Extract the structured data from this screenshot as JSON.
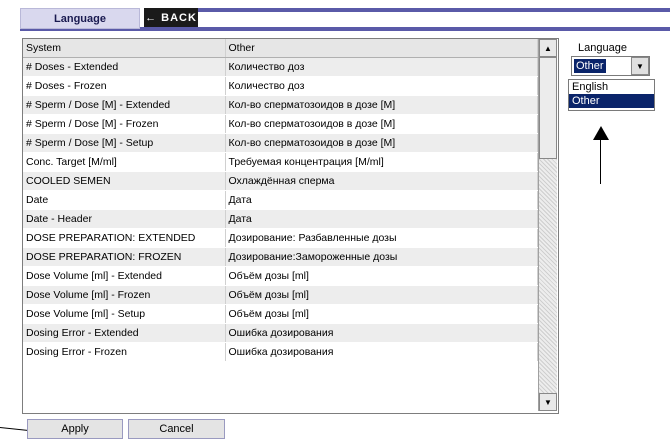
{
  "header": {
    "tab_label": "Language",
    "back_label": "← BACK"
  },
  "table": {
    "columns": [
      "System",
      "Other"
    ],
    "rows": [
      [
        "# Doses - Extended",
        "Количество доз"
      ],
      [
        "# Doses - Frozen",
        "Количество доз"
      ],
      [
        "# Sperm / Dose [M] - Extended",
        "Кол-во сперматозоидов в дозе [M]"
      ],
      [
        "# Sperm / Dose [M] - Frozen",
        "Кол-во сперматозоидов в дозе [M]"
      ],
      [
        "# Sperm / Dose [M] - Setup",
        "Кол-во сперматозоидов в дозе [M]"
      ],
      [
        "Conc. Target [M/ml]",
        "Требуемая концентрация [M/ml]"
      ],
      [
        "COOLED SEMEN",
        "Охлаждённая сперма"
      ],
      [
        "Date",
        "Дата"
      ],
      [
        "Date - Header",
        "Дата"
      ],
      [
        "DOSE PREPARATION: EXTENDED",
        "Дозирование: Разбавленные дозы"
      ],
      [
        "DOSE PREPARATION: FROZEN",
        "Дозирование:Замороженные дозы"
      ],
      [
        "Dose Volume [ml] - Extended",
        "Объём дозы [ml]"
      ],
      [
        "Dose Volume [ml] - Frozen",
        "Объём дозы [ml]"
      ],
      [
        "Dose Volume [ml] - Setup",
        "Объём дозы [ml]"
      ],
      [
        "Dosing Error - Extended",
        "Ошибка дозирования"
      ],
      [
        "Dosing Error - Frozen",
        "Ошибка дозирования"
      ]
    ]
  },
  "language_panel": {
    "label": "Language",
    "selected": "Other",
    "options": [
      "English",
      "Other"
    ]
  },
  "buttons": {
    "apply": "Apply",
    "cancel": "Cancel"
  }
}
